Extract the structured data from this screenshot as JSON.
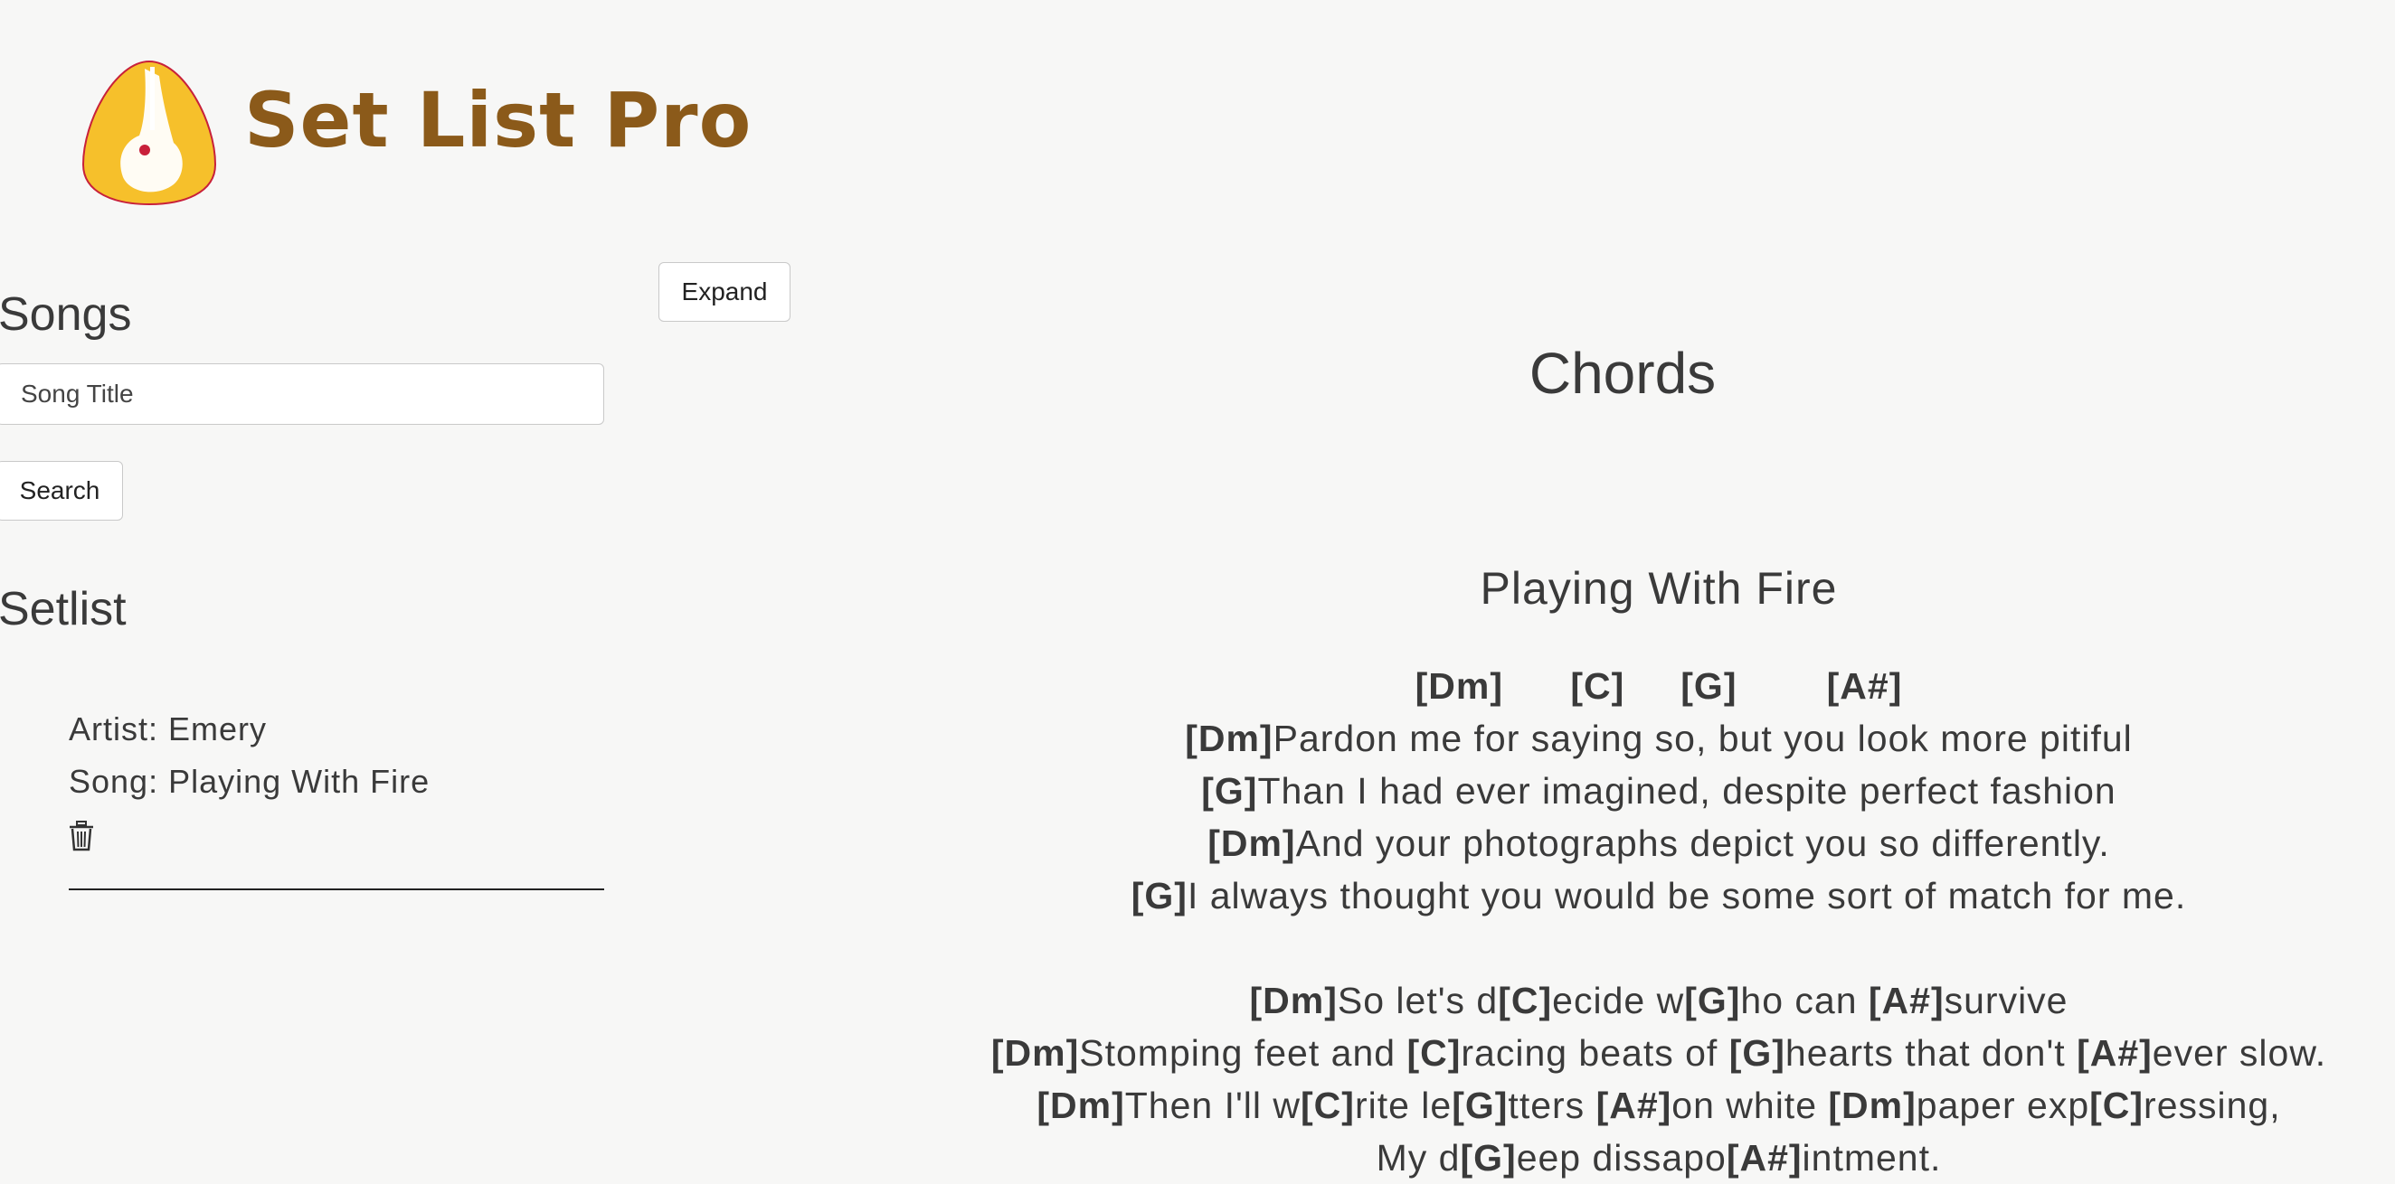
{
  "app": {
    "brand": "Set List Pro",
    "colors": {
      "brand": "#8b5a1a",
      "logo_fill": "#f6c02b",
      "logo_outline": "#c8203a"
    }
  },
  "sidebar": {
    "expand_label": "Expand",
    "songs_heading": "Songs",
    "search": {
      "placeholder": "Song Title",
      "value": ""
    },
    "search_label": "Search",
    "setlist_heading": "Setlist",
    "setlist_items": [
      {
        "artist_line": "Artist: Emery",
        "song_line": "Song: Playing With Fire",
        "delete_icon": "trash-icon"
      }
    ]
  },
  "main": {
    "heading": "Chords",
    "song_title": "Playing With Fire",
    "chord_lines": [
      "[Dm]      [C]     [G]        [A#]",
      "[Dm]Pardon me for saying so, but you look more pitiful",
      "[G]Than I had ever imagined, despite perfect fashion",
      "[Dm]And your photographs depict you so differently.",
      "[G]I always thought you would be some sort of match for me.",
      "",
      "[Dm]So let's d[C]ecide w[G]ho can [A#]survive",
      "[Dm]Stomping feet and [C]racing beats of [G]hearts that don't [A#]ever slow.",
      "[Dm]Then I'll w[C]rite le[G]tters [A#]on white [Dm]paper exp[C]ressing,",
      "My d[G]eep dissapo[A#]intment."
    ]
  }
}
